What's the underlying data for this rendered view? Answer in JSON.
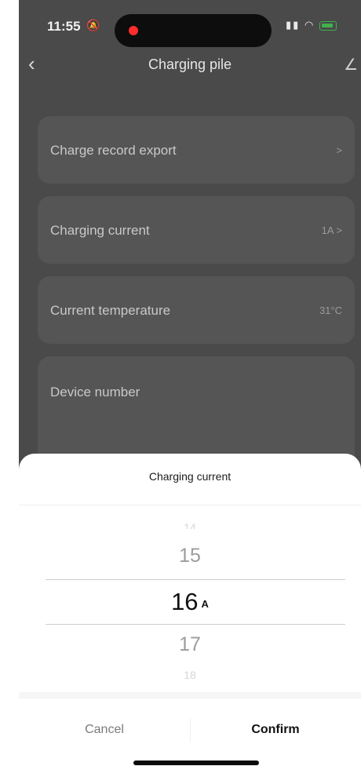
{
  "status_bar": {
    "time": "11:55",
    "bell_icon": "bell-slash-icon",
    "signal_icon": "signal-icon",
    "wifi_icon": "wifi-icon",
    "battery_icon": "battery-charging-icon"
  },
  "nav": {
    "back_icon": "chevron-left-icon",
    "title": "Charging pile",
    "edit_icon": "edit-icon"
  },
  "settings": [
    {
      "label": "Charge record export",
      "value": ">"
    },
    {
      "label": "Charging current",
      "value": "1A >"
    },
    {
      "label": "Current temperature",
      "value": "31°C"
    },
    {
      "label": "Device number",
      "value": ""
    }
  ],
  "sheet": {
    "title": "Charging current",
    "picker": {
      "far_above": "14",
      "above": "15",
      "selected": "16",
      "unit": "A",
      "below": "17",
      "far_below": "18"
    },
    "cancel_label": "Cancel",
    "confirm_label": "Confirm"
  },
  "colors": {
    "overlay": "#4a4a4a",
    "sheet_bg": "#ffffff",
    "selected_text": "#111111",
    "muted_text": "#9c9c9c"
  }
}
